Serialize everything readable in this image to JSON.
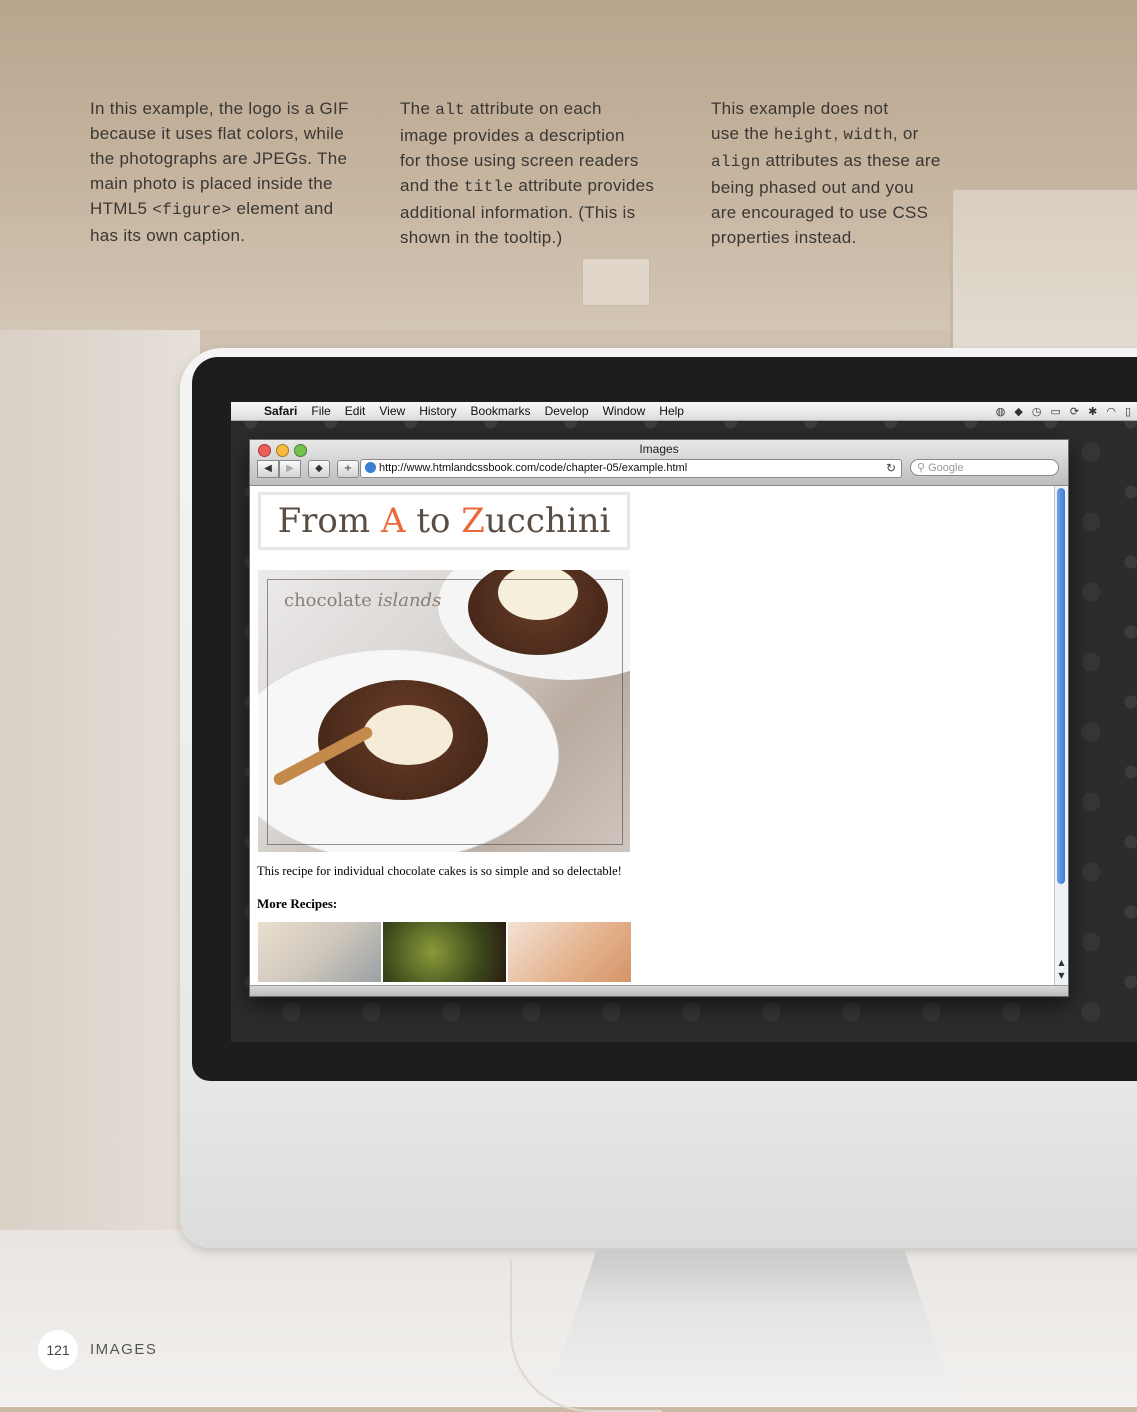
{
  "captions": {
    "col1": [
      "In this example, the logo is a GIF",
      "because it uses flat colors, while",
      "the photographs are JPEGs. The",
      "main photo is placed inside the",
      "HTML5 ",
      "<figure>",
      " element and",
      "has its own caption."
    ],
    "col2": {
      "l1a": "The ",
      "l1b": "alt",
      "l1c": " attribute on each",
      "l2": "image provides a description",
      "l3": "for those using screen readers",
      "l4a": "and the ",
      "l4b": "title",
      "l4c": " attribute provides",
      "l5": "additional information. (This is",
      "l6": "shown in the tooltip.)"
    },
    "col3": {
      "l1": "This example does not",
      "l2a": "use the ",
      "l2b": "height",
      "l2c": ", ",
      "l2d": "width",
      "l2e": ", or",
      "l3a": "align",
      "l3b": " attributes as these are",
      "l4": "being phased out and you",
      "l5": "are encouraged to use CSS",
      "l6": "properties instead."
    }
  },
  "menubar": {
    "items": [
      "Safari",
      "File",
      "Edit",
      "View",
      "History",
      "Bookmarks",
      "Develop",
      "Window",
      "Help"
    ]
  },
  "safari": {
    "window_title": "Images",
    "url": "http://www.htmlandcssbook.com/code/chapter-05/example.html",
    "search_placeholder": "Google"
  },
  "webpage": {
    "logo": {
      "part1": "From ",
      "a": "A",
      "part2": " to ",
      "z": "Z",
      "part3": "ucchini"
    },
    "photo_label": {
      "plain": "chocolate ",
      "italic": "islands"
    },
    "description": "This recipe for individual chocolate cakes is so simple and so delectable!",
    "more_heading": "More Recipes:"
  },
  "footer": {
    "page_number": "121",
    "section": "IMAGES"
  },
  "colors": {
    "logo_accent": "#e86a3b",
    "screen_bg": "#2c2c2e",
    "scroll_thumb": "#3f7bd7"
  }
}
